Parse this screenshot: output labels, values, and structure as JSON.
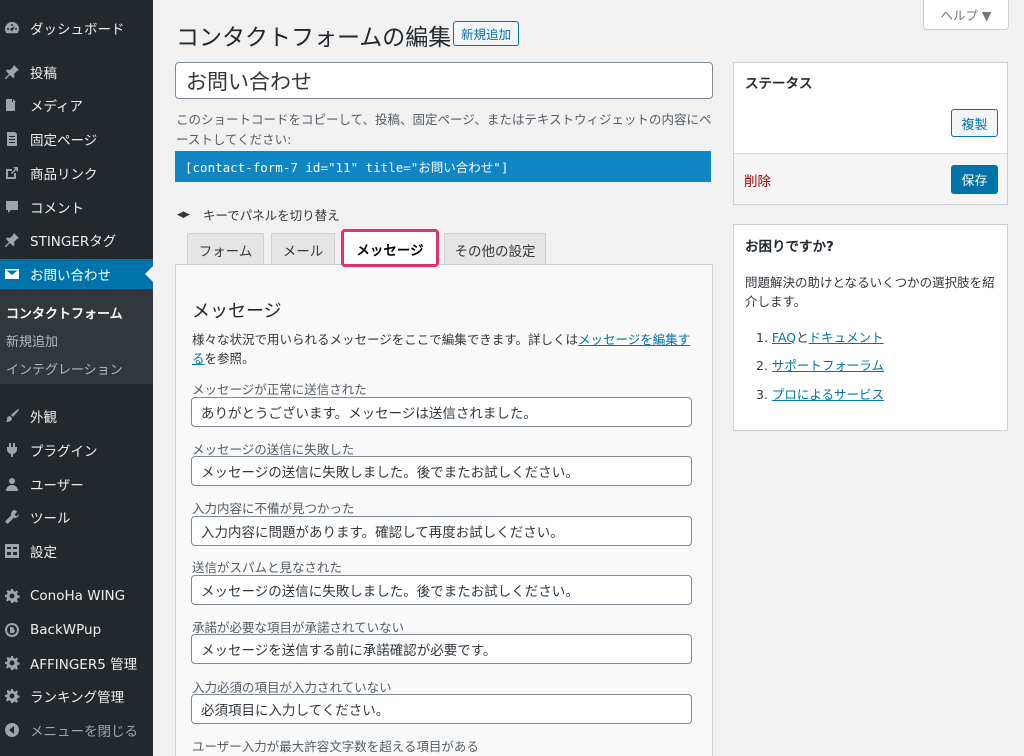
{
  "sidebar": {
    "items": [
      {
        "label": "ダッシュボード",
        "icon": "dashboard-icon"
      },
      {
        "label": "投稿",
        "icon": "pin-icon"
      },
      {
        "label": "メディア",
        "icon": "media-icon"
      },
      {
        "label": "固定ページ",
        "icon": "page-icon"
      },
      {
        "label": "商品リンク",
        "icon": "external-link-icon"
      },
      {
        "label": "コメント",
        "icon": "comment-icon"
      },
      {
        "label": "STINGERタグ",
        "icon": "pin-icon"
      },
      {
        "label": "お問い合わせ",
        "icon": "mail-icon"
      },
      {
        "label": "外観",
        "icon": "brush-icon"
      },
      {
        "label": "プラグイン",
        "icon": "plugin-icon"
      },
      {
        "label": "ユーザー",
        "icon": "user-icon"
      },
      {
        "label": "ツール",
        "icon": "wrench-icon"
      },
      {
        "label": "設定",
        "icon": "settings-icon"
      },
      {
        "label": "ConoHa WING",
        "icon": "gear-icon"
      },
      {
        "label": "BackWPup",
        "icon": "backwpup-icon"
      },
      {
        "label": "AFFINGER5 管理",
        "icon": "gear-icon"
      },
      {
        "label": "ランキング管理",
        "icon": "gear-icon"
      },
      {
        "label": "メニューを閉じる",
        "icon": "collapse-icon"
      }
    ],
    "submenu": [
      {
        "label": "コンタクトフォーム"
      },
      {
        "label": "新規追加"
      },
      {
        "label": "インテグレーション"
      }
    ]
  },
  "header": {
    "title": "コンタクトフォームの編集",
    "add_new": "新規追加",
    "help": "ヘルプ ▼"
  },
  "form": {
    "title_value": "お問い合わせ",
    "shortcode_desc": "このショートコードをコピーして、投稿、固定ページ、またはテキストウィジェットの内容にペーストしてください:",
    "shortcode": "[contact-form-7 id=\"11\" title=\"お問い合わせ\"]",
    "keyboard_hint": "キーでパネルを切り替え"
  },
  "tabs": [
    {
      "label": "フォーム"
    },
    {
      "label": "メール"
    },
    {
      "label": "メッセージ"
    },
    {
      "label": "その他の設定"
    }
  ],
  "panel": {
    "heading": "メッセージ",
    "desc_before": "様々な状況で用いられるメッセージをここで編集できます。詳しくは",
    "desc_link": "メッセージを編集する",
    "desc_after": "を参照。",
    "fields": [
      {
        "label": "メッセージが正常に送信された",
        "value": "ありがとうございます。メッセージは送信されました。"
      },
      {
        "label": "メッセージの送信に失敗した",
        "value": "メッセージの送信に失敗しました。後でまたお試しください。"
      },
      {
        "label": "入力内容に不備が見つかった",
        "value": "入力内容に問題があります。確認して再度お試しください。"
      },
      {
        "label": "送信がスパムと見なされた",
        "value": "メッセージの送信に失敗しました。後でまたお試しください。"
      },
      {
        "label": "承諾が必要な項目が承諾されていない",
        "value": "メッセージを送信する前に承諾確認が必要です。"
      },
      {
        "label": "入力必須の項目が入力されていない",
        "value": "必須項目に入力してください。"
      },
      {
        "label": "ユーザー入力が最大許容文字数を超える項目がある",
        "value": ""
      }
    ]
  },
  "status_box": {
    "title": "ステータス",
    "duplicate": "複製",
    "delete": "削除",
    "save": "保存"
  },
  "help_box": {
    "title": "お困りですか?",
    "desc": "問題解決の助けとなるいくつかの選択肢を紹介します。",
    "items": [
      {
        "num": "1.",
        "link1": "FAQ",
        "sep": "と",
        "link2": "ドキュメント"
      },
      {
        "num": "2.",
        "link1": "サポートフォーラム"
      },
      {
        "num": "3.",
        "link1": "プロによるサービス"
      }
    ]
  },
  "colors": {
    "sidebar_bg": "#23282d",
    "accent": "#0073aa",
    "highlight": "#e5306f",
    "delete": "#aa0000"
  }
}
